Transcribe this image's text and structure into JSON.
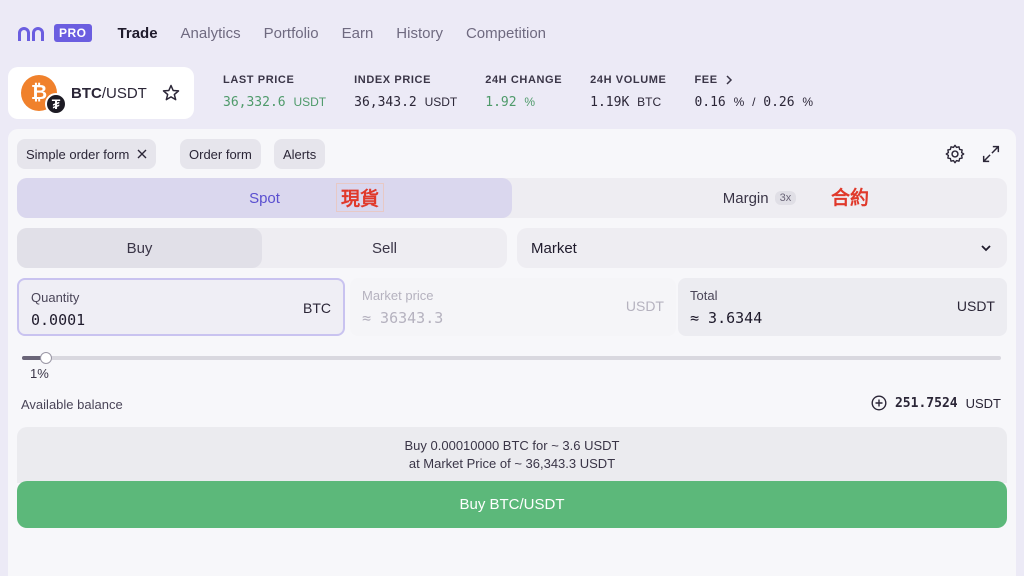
{
  "nav": {
    "badge": "PRO",
    "items": [
      "Trade",
      "Analytics",
      "Portfolio",
      "Earn",
      "History",
      "Competition"
    ]
  },
  "pair": {
    "base": "BTC",
    "quote": "/USDT",
    "base_icon": "bitcoin-icon",
    "quote_icon": "tether-icon"
  },
  "stats": {
    "last_price": {
      "label": "LAST PRICE",
      "value": "36,332.6",
      "unit": "USDT"
    },
    "index_price": {
      "label": "INDEX PRICE",
      "value": "36,343.2",
      "unit": "USDT"
    },
    "change_24h": {
      "label": "24H CHANGE",
      "value": "1.92",
      "unit": "%"
    },
    "volume_24h": {
      "label": "24H VOLUME",
      "value": "1.19K",
      "unit": "BTC"
    },
    "fee": {
      "label": "FEE",
      "maker": "0.16",
      "taker": "0.26",
      "unit": "%",
      "sep": "/"
    }
  },
  "chips": {
    "simple": "Simple order form",
    "order": "Order form",
    "alerts": "Alerts"
  },
  "tabs": {
    "spot": "Spot",
    "margin": "Margin",
    "leverage": "3x"
  },
  "annotations": {
    "spot": "現貨",
    "margin": "合約"
  },
  "side": {
    "buy": "Buy",
    "sell": "Sell"
  },
  "order_type": "Market",
  "quantity": {
    "label": "Quantity",
    "value": "0.0001",
    "unit": "BTC"
  },
  "market_price": {
    "label": "Market price",
    "value": "≈ 36343.3",
    "unit": "USDT"
  },
  "total": {
    "label": "Total",
    "value": "≈ 3.6344",
    "unit": "USDT"
  },
  "slider": {
    "percent": 1,
    "label": "1%"
  },
  "balance": {
    "label": "Available balance",
    "value": "251.7524",
    "unit": "USDT"
  },
  "summary": {
    "line1": "Buy 0.00010000 BTC for ~ 3.6 USDT",
    "line2": "at Market Price of ~ 36,343.3 USDT"
  },
  "buy_button": "Buy BTC/USDT",
  "colors": {
    "accent": "#5a4fd0",
    "buy": "#5cb87a",
    "positive": "#4e9a6a",
    "annotation": "#e0392b"
  }
}
